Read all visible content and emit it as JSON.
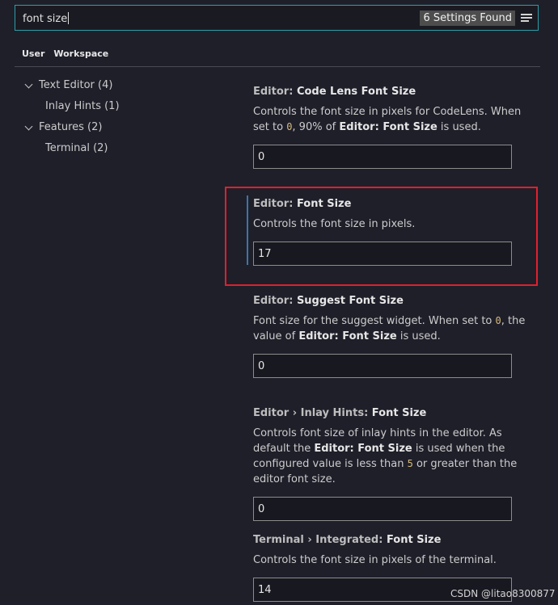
{
  "search": {
    "value": "font size",
    "results_count": "6 Settings Found",
    "filter_icon": "filter-list-icon"
  },
  "tabs": {
    "user": "User",
    "workspace": "Workspace"
  },
  "toc": [
    {
      "label": "Text Editor (4)",
      "expanded": true
    },
    {
      "label": "Inlay Hints (1)"
    },
    {
      "label": "Features (2)",
      "expanded": true
    },
    {
      "label": "Terminal (2)"
    }
  ],
  "settings": [
    {
      "category": "Editor: ",
      "name": "Code Lens Font Size",
      "desc": {
        "before": "Controls the font size in pixels for CodeLens. When set to ",
        "code": "0",
        "middle": ", 90% of ",
        "ref": "Editor: Font Size",
        "after": " is used."
      },
      "value": "0"
    },
    {
      "category": "Editor: ",
      "name": "Font Size",
      "desc": {
        "text": "Controls the font size in pixels."
      },
      "value": "17",
      "highlighted": true
    },
    {
      "category": "Editor: ",
      "name": "Suggest Font Size",
      "desc": {
        "before": "Font size for the suggest widget. When set to ",
        "code": "0",
        "middle": ", the value of ",
        "ref": "Editor: Font Size",
        "after": " is used."
      },
      "value": "0"
    },
    {
      "category": "Editor › Inlay Hints: ",
      "name": "Font Size",
      "desc": {
        "before": "Controls font size of inlay hints in the editor. As default the ",
        "ref": "Editor: Font Size",
        "middle": " is used when the configured value is less than ",
        "code": "5",
        "after": " or greater than the editor font size."
      },
      "value": "0"
    },
    {
      "category": "Terminal › Integrated: ",
      "name": "Font Size",
      "desc": {
        "text": "Controls the font size in pixels of the terminal."
      },
      "value": "14"
    }
  ],
  "watermark": "CSDN @litao8300877",
  "colors": {
    "background": "#1f1f2a",
    "search_border": "#2b9fa8",
    "highlight_frame": "#e0202c",
    "focus_bar": "#3878a8",
    "code_literal": "#d7ba7d"
  }
}
